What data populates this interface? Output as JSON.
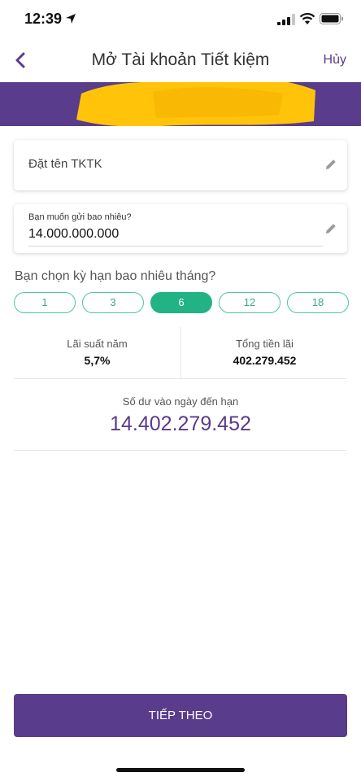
{
  "status": {
    "time": "12:39"
  },
  "nav": {
    "title": "Mở Tài khoản Tiết kiệm",
    "cancel": "Hủy"
  },
  "form": {
    "name_placeholder": "Đặt tên TKTK",
    "amount_label": "Bạn muốn gửi bao nhiêu?",
    "amount_value": "14.000.000.000"
  },
  "term": {
    "question": "Bạn chọn kỳ hạn bao nhiêu tháng?",
    "options": [
      "1",
      "3",
      "6",
      "12",
      "18"
    ],
    "selected": "6"
  },
  "stats": {
    "rate_label": "Lãi suất năm",
    "rate_value": "5,7%",
    "interest_label": "Tổng tiền lãi",
    "interest_value": "402.279.452"
  },
  "balance": {
    "label": "Số dư vào ngày đến hạn",
    "value": "14.402.279.452"
  },
  "actions": {
    "next": "TIẾP THEO"
  },
  "colors": {
    "brand_purple": "#593c8b",
    "accent_green": "#22b384",
    "redaction_yellow": "#ffc40a"
  },
  "icons": [
    "location-arrow-icon",
    "signal-icon",
    "wifi-icon",
    "battery-icon",
    "back-chevron-icon",
    "pencil-icon"
  ]
}
